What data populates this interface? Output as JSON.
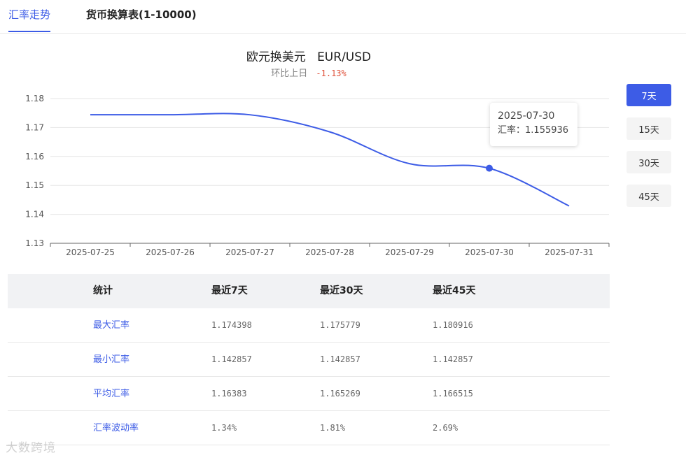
{
  "tabs": {
    "active": "汇率走势",
    "inactive": "货币换算表(1-10000)"
  },
  "chart_header": {
    "title": "欧元换美元   EUR/USD",
    "change_label": "环比上日",
    "change_value": "-1.13%"
  },
  "tooltip": {
    "date": "2025-07-30",
    "rate_label": "汇率：",
    "rate_value": "1.155936"
  },
  "range_buttons": [
    "7天",
    "15天",
    "30天",
    "45天"
  ],
  "active_range": "7天",
  "colors": {
    "accent": "#3d5ce6",
    "line": "#3d5ce6",
    "negative": "#e0533d"
  },
  "stats": {
    "headers": [
      "统计",
      "最近7天",
      "最近30天",
      "最近45天"
    ],
    "rows": [
      {
        "label": "最大汇率",
        "values": [
          "1.174398",
          "1.175779",
          "1.180916"
        ]
      },
      {
        "label": "最小汇率",
        "values": [
          "1.142857",
          "1.142857",
          "1.142857"
        ]
      },
      {
        "label": "平均汇率",
        "values": [
          "1.16383",
          "1.165269",
          "1.166515"
        ]
      },
      {
        "label": "汇率波动率",
        "values": [
          "1.34%",
          "1.81%",
          "2.69%"
        ]
      }
    ]
  },
  "watermark": "大数跨境",
  "chart_data": {
    "type": "line",
    "x": [
      "2025-07-25",
      "2025-07-26",
      "2025-07-27",
      "2025-07-28",
      "2025-07-29",
      "2025-07-30",
      "2025-07-31"
    ],
    "series": [
      {
        "values": [
          1.1744,
          1.1744,
          1.1744,
          1.1685,
          1.1575,
          1.1559,
          1.1429
        ]
      }
    ],
    "yticks": [
      "1.13",
      "1.14",
      "1.15",
      "1.16",
      "1.17",
      "1.18"
    ],
    "ylim": [
      1.13,
      1.18
    ],
    "grid": true,
    "highlight": {
      "x": "2025-07-30",
      "value": 1.155936
    }
  }
}
